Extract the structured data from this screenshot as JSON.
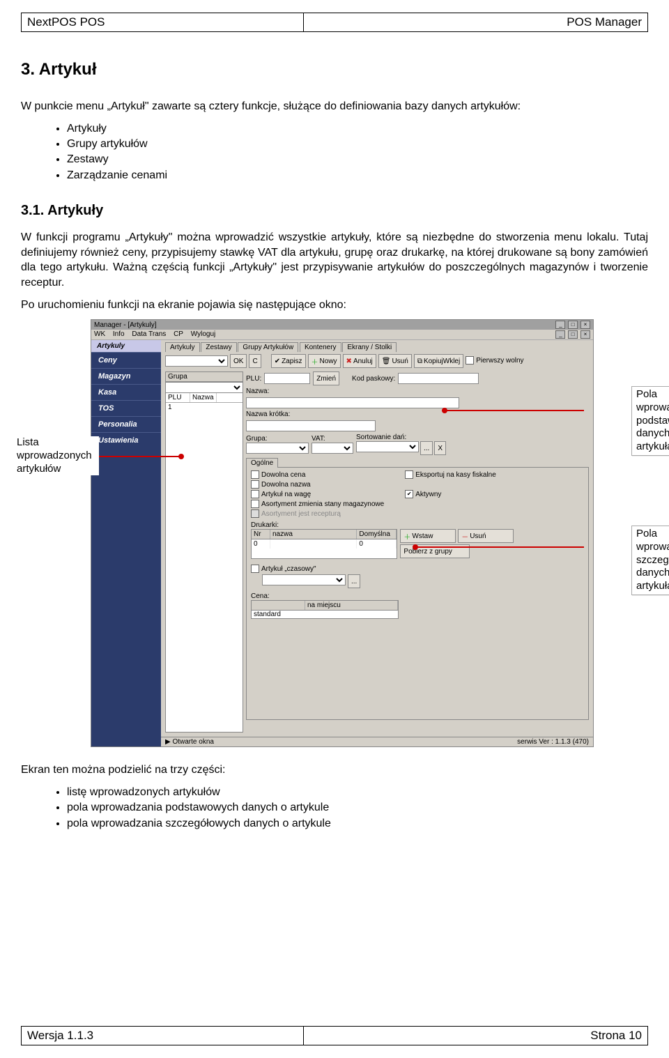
{
  "header": {
    "left": "NextPOS POS",
    "right": "POS Manager"
  },
  "footer": {
    "left": "Wersja 1.1.3",
    "right": "Strona 10"
  },
  "section_title": "3. Artykuł",
  "intro_para": "W punkcie menu „Artykuł\" zawarte są cztery funkcje, służące do definiowania bazy danych artykułów:",
  "intro_bullets": [
    "Artykuły",
    "Grupy artykułów",
    "Zestawy",
    "Zarządzanie cenami"
  ],
  "subsection_title": "3.1. Artykuły",
  "sub_para": "W funkcji programu „Artykuły\" można wprowadzić wszystkie artykuły, które są niezbędne do stworzenia menu lokalu. Tutaj definiujemy również ceny, przypisujemy stawkę VAT dla artykułu, grupę oraz drukarkę, na której drukowane są bony zamówień dla tego artykułu. Ważną częścią funkcji „Artykuły\" jest przypisywanie artykułów do poszczególnych magazynów i tworzenie receptur.",
  "after_shot_para": "Po uruchomieniu funkcji na ekranie pojawia się następujące okno:",
  "callouts": {
    "left": "Lista wprowadzonych artykułów",
    "right1": "Pola wprowadzania podstawowych danych o artykułach",
    "right2": "Pola wprowadzania szczegółowych danych o artykułach"
  },
  "after_text_lead": "Ekran ten można podzielić na trzy części:",
  "after_bullets": [
    "listę wprowadzonych artykułów",
    "pola wprowadzania podstawowych danych o artykule",
    "pola wprowadzania szczegółowych danych o artykule"
  ],
  "app": {
    "titlebar": "Manager - [Artykuly]",
    "menu": [
      "WK",
      "Info",
      "Data Trans",
      "CP",
      "Wyloguj"
    ],
    "sidebar": {
      "selected": "Artykuly",
      "items": [
        "Ceny",
        "Magazyn",
        "Kasa",
        "TOS",
        "Personalia",
        "Ustawienia"
      ]
    },
    "tabs": [
      "Artykuly",
      "Zestawy",
      "Grupy Artykułów",
      "Kontenery",
      "Ekrany / Stolki"
    ],
    "toolbar": {
      "ok": "OK",
      "c": "C",
      "zapisz": "Zapisz",
      "nowy": "Nowy",
      "anuluj": "Anuluj",
      "usun": "Usuń",
      "kopiuj": "KopiujWklej",
      "pierwszy": "Pierwszy wolny"
    },
    "list": {
      "grupa_lbl": "Grupa",
      "hdr_plu": "PLU",
      "hdr_nazwa": "Nazwa",
      "row_plu": "1",
      "row_nazwa": ""
    },
    "form": {
      "plu_lbl": "PLU:",
      "zmien": "Zmień",
      "kod_lbl": "Kod paskowy:",
      "nazwa_lbl": "Nazwa:",
      "nazwa_krotka_lbl": "Nazwa krótka:",
      "grupa_lbl": "Grupa:",
      "vat_lbl": "VAT:",
      "sort_lbl": "Sortowanie dań:",
      "x_btn": "X",
      "subtab": "Ogólne",
      "chk_dowolna_cena": "Dowolna cena",
      "chk_eksportuj": "Eksportuj na kasy fiskalne",
      "chk_dowolna_nazwa": "Dowolna nazwa",
      "chk_na_wage": "Artykuł na wagę",
      "chk_aktywny": "Aktywny",
      "chk_asortyment": "Asortyment zmienia stany magazynowe",
      "chk_receptura": "Asortyment jest recepturą",
      "drukarki_lbl": "Drukarki:",
      "dhdr_nr": "Nr",
      "dhdr_nazwa": "nazwa",
      "dhdr_dom": "Domyślna",
      "drow_nr": "0",
      "drow_dom": "0",
      "wstaw": "Wstaw",
      "usun2": "Usuń",
      "pobierz": "Pobierz z grupy",
      "chk_czasowy": "Artykuł „czasowy\"",
      "cena_lbl": "Cena:",
      "cena_hdr_na": "na miejscu",
      "cena_row_std": "standard"
    },
    "statusbar": {
      "left": "▶ Otwarte okna",
      "right": "serwis  Ver : 1.1.3 (470)"
    }
  }
}
